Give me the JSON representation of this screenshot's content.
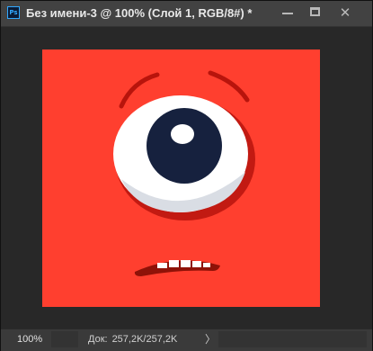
{
  "window": {
    "app_icon": "Ps",
    "title": "Без имени-3 @ 100% (Слой 1, RGB/8#) *",
    "controls": {
      "minimize_icon": "minimize-icon",
      "maximize_icon": "maximize-icon",
      "close_icon": "close-icon",
      "close_glyph": "✕"
    }
  },
  "canvas": {
    "background_color": "#ff3f2f",
    "artwork": "red-monster-face"
  },
  "status_bar": {
    "zoom": "100%",
    "doc_label": "Док:",
    "doc_size": "257,2K/257,2K",
    "arrow_glyph": "〉"
  }
}
